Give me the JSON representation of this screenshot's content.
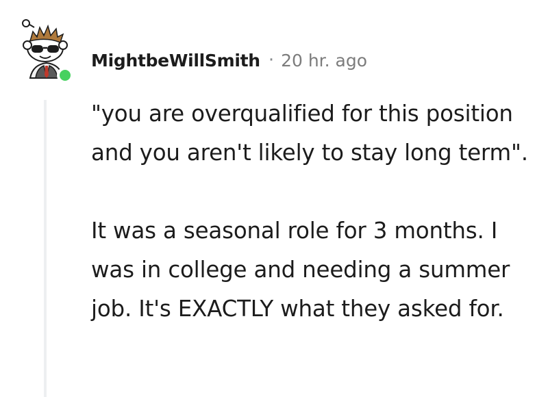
{
  "comment": {
    "author": "MightbeWillSmith",
    "separator": "·",
    "timestamp": "20 hr. ago",
    "avatar_icon": "snoo-avatar-sunglasses-icon",
    "online_indicator_color": "#46d160",
    "paragraphs": [
      "\"you are overqualified for this position and you aren't likely to stay long term\".",
      "It was a seasonal role for 3 months. I was in college and needing a summer job. It's EXACTLY what they asked for."
    ]
  }
}
